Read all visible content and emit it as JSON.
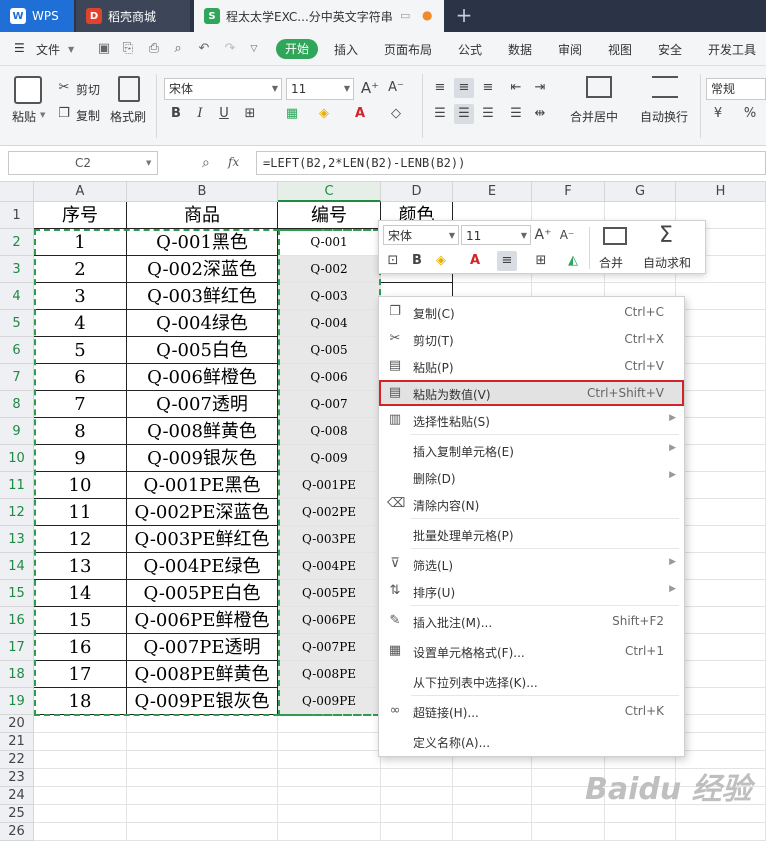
{
  "tabs": {
    "wps": "WPS",
    "store": "稻壳商城",
    "doc": "程太太学EXC...分中英文字符串"
  },
  "menubar": {
    "file": "文件",
    "items": [
      "开始",
      "插入",
      "页面布局",
      "公式",
      "数据",
      "审阅",
      "视图",
      "安全",
      "开发工具"
    ]
  },
  "ribbon": {
    "paste": "粘贴",
    "cut": "剪切",
    "copy": "复制",
    "format_painter": "格式刷",
    "font_name": "宋体",
    "font_size": "11",
    "merge_center": "合并居中",
    "wrap_text": "自动换行",
    "number_format": "常规"
  },
  "formula_bar": {
    "name_box": "C2",
    "fx": "fx",
    "formula": "=LEFT(B2,2*LEN(B2)-LENB(B2))"
  },
  "columns": [
    "A",
    "B",
    "C",
    "D",
    "E",
    "F",
    "G",
    "H"
  ],
  "rows": [
    "1",
    "2",
    "3",
    "4",
    "5",
    "6",
    "7",
    "8",
    "9",
    "10",
    "11",
    "12",
    "13",
    "14",
    "15",
    "16",
    "17",
    "18",
    "19",
    "20",
    "21",
    "22",
    "23",
    "24",
    "25",
    "26"
  ],
  "header": {
    "a": "序号",
    "b": "商品",
    "c": "编号",
    "d": "颜色"
  },
  "table": [
    {
      "a": "1",
      "b": "Q-001黑色",
      "c": "Q-001"
    },
    {
      "a": "2",
      "b": "Q-002深蓝色",
      "c": "Q-002"
    },
    {
      "a": "3",
      "b": "Q-003鲜红色",
      "c": "Q-003"
    },
    {
      "a": "4",
      "b": "Q-004绿色",
      "c": "Q-004"
    },
    {
      "a": "5",
      "b": "Q-005白色",
      "c": "Q-005"
    },
    {
      "a": "6",
      "b": "Q-006鲜橙色",
      "c": "Q-006"
    },
    {
      "a": "7",
      "b": "Q-007透明",
      "c": "Q-007"
    },
    {
      "a": "8",
      "b": "Q-008鲜黄色",
      "c": "Q-008"
    },
    {
      "a": "9",
      "b": "Q-009银灰色",
      "c": "Q-009"
    },
    {
      "a": "10",
      "b": "Q-001PE黑色",
      "c": "Q-001PE"
    },
    {
      "a": "11",
      "b": "Q-002PE深蓝色",
      "c": "Q-002PE"
    },
    {
      "a": "12",
      "b": "Q-003PE鲜红色",
      "c": "Q-003PE"
    },
    {
      "a": "13",
      "b": "Q-004PE绿色",
      "c": "Q-004PE"
    },
    {
      "a": "14",
      "b": "Q-005PE白色",
      "c": "Q-005PE"
    },
    {
      "a": "15",
      "b": "Q-006PE鲜橙色",
      "c": "Q-006PE"
    },
    {
      "a": "16",
      "b": "Q-007PE透明",
      "c": "Q-007PE"
    },
    {
      "a": "17",
      "b": "Q-008PE鲜黄色",
      "c": "Q-008PE"
    },
    {
      "a": "18",
      "b": "Q-009PE银灰色",
      "c": "Q-009PE"
    }
  ],
  "mini_toolbar": {
    "font_name": "宋体",
    "font_size": "11",
    "merge": "合并",
    "autosum": "自动求和"
  },
  "context_menu": [
    {
      "label": "复制(C)",
      "shortcut": "Ctrl+C",
      "icon": "copy-icon"
    },
    {
      "label": "剪切(T)",
      "shortcut": "Ctrl+X",
      "icon": "scissors-icon"
    },
    {
      "label": "粘贴(P)",
      "shortcut": "Ctrl+V",
      "icon": "paste-icon"
    },
    {
      "label": "粘贴为数值(V)",
      "shortcut": "Ctrl+Shift+V",
      "icon": "paste-values-icon"
    },
    {
      "label": "选择性粘贴(S)",
      "shortcut": "",
      "icon": "paste-special-icon"
    },
    {
      "label": "插入复制单元格(E)",
      "shortcut": "",
      "icon": ""
    },
    {
      "label": "删除(D)",
      "shortcut": "",
      "icon": ""
    },
    {
      "label": "清除内容(N)",
      "shortcut": "",
      "icon": "eraser-icon"
    },
    {
      "label": "批量处理单元格(P)",
      "shortcut": "",
      "icon": ""
    },
    {
      "label": "筛选(L)",
      "shortcut": "",
      "icon": "filter-icon"
    },
    {
      "label": "排序(U)",
      "shortcut": "",
      "icon": "sort-icon"
    },
    {
      "label": "插入批注(M)...",
      "shortcut": "Shift+F2",
      "icon": "comment-icon"
    },
    {
      "label": "设置单元格格式(F)...",
      "shortcut": "Ctrl+1",
      "icon": "format-cells-icon"
    },
    {
      "label": "从下拉列表中选择(K)...",
      "shortcut": "",
      "icon": ""
    },
    {
      "label": "超链接(H)...",
      "shortcut": "Ctrl+K",
      "icon": "link-icon"
    },
    {
      "label": "定义名称(A)...",
      "shortcut": "",
      "icon": ""
    }
  ],
  "colors": {
    "accent_green": "#2fa65a",
    "selection_green": "#1e8a43",
    "highlight_red": "#d0232a"
  }
}
